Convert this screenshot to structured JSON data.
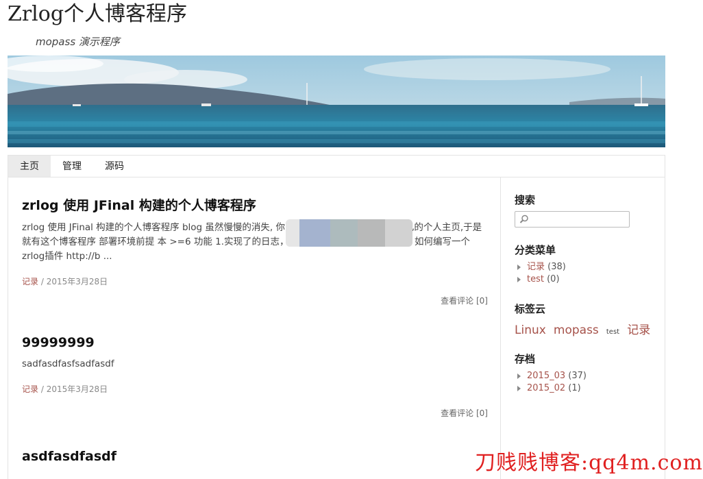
{
  "header": {
    "site_title": "Zrlog个人博客程序",
    "subtitle": "mopass 演示程序"
  },
  "nav": {
    "items": [
      {
        "label": "主页",
        "active": true
      },
      {
        "label": "管理",
        "active": false
      },
      {
        "label": "源码",
        "active": false
      }
    ]
  },
  "posts": [
    {
      "title": "zrlog 使用 JFinal 构建的个人博客程序",
      "body": "zrlog 使用 JFinal 构建的个人博客程序 blog 虽然慢慢的消失, 你 微博,微信等,而是希望有个自己的个人主页,于是就有这个博客程序 部署环境前提 本 >=6 功能 1.实现了的日志，分类，的管理 2.支持插件模式 如何编写一个zrlog插件 http://b ...",
      "category": "记录",
      "date": "2015年3月28日",
      "comments": "查看评论 [0]"
    },
    {
      "title": "99999999",
      "body": "sadfasdfasfsadfasdf",
      "category": "记录",
      "date": "2015年3月28日",
      "comments": "查看评论 [0]"
    },
    {
      "title": "asdfasdfasdf"
    }
  ],
  "sidebar": {
    "search": {
      "title": "搜索",
      "placeholder": "",
      "icon": "search-icon"
    },
    "categories": {
      "title": "分类菜单",
      "items": [
        {
          "name": "记录",
          "count": "(38)"
        },
        {
          "name": "test",
          "count": "(0)"
        }
      ]
    },
    "tags": {
      "title": "标签云",
      "items": [
        "Linux",
        "mopass",
        "test",
        "记录"
      ]
    },
    "archives": {
      "title": "存档",
      "items": [
        {
          "name": "2015_03",
          "count": "(37)"
        },
        {
          "name": "2015_02",
          "count": "(1)"
        }
      ]
    }
  },
  "watermark": "刀贱贱博客:qq4m.com",
  "colors": {
    "accent_link": "#a6524a",
    "watermark": "#e02020"
  }
}
